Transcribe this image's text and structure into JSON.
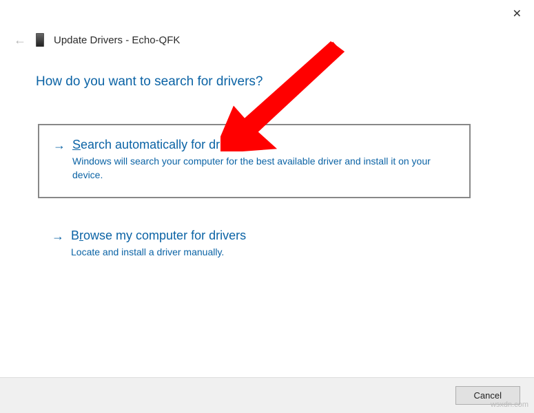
{
  "window": {
    "close_glyph": "✕",
    "back_glyph": "←",
    "title": "Update Drivers - Echo-QFK"
  },
  "heading": "How do you want to search for drivers?",
  "options": [
    {
      "arrow": "→",
      "title_pre": "",
      "title_accel": "S",
      "title_post": "earch automatically for drivers",
      "description": "Windows will search your computer for the best available driver and install it on your device."
    },
    {
      "arrow": "→",
      "title_pre": "B",
      "title_accel": "r",
      "title_post": "owse my computer for drivers",
      "description": "Locate and install a driver manually."
    }
  ],
  "footer": {
    "cancel": "Cancel"
  },
  "watermark": "wsxdn.com",
  "annotation": {
    "color": "#ff0000"
  }
}
